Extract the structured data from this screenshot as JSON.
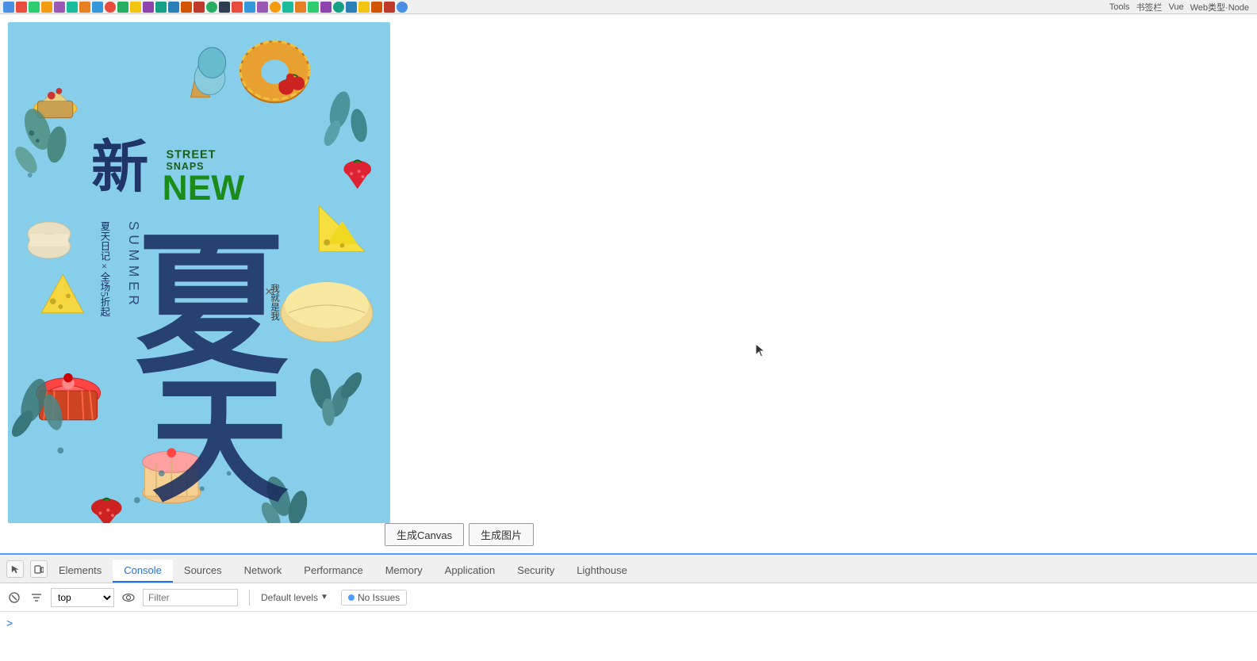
{
  "browser": {
    "topbar_bg": "#f0f0f0"
  },
  "poster": {
    "bg_color": "#87CEEB",
    "text_xin": "新",
    "text_street": "STREET",
    "text_snaps": "SNAPS",
    "text_new": "NEW",
    "text_xiatian": "夏天",
    "text_summer": "SUMMER",
    "text_riji": "夏天日记×全场5折起",
    "text_cross": "×",
    "text_wo": "我就是我"
  },
  "buttons": {
    "generate_canvas": "生成Canvas",
    "generate_image": "生成图片"
  },
  "devtools": {
    "tabs": [
      {
        "label": "Elements",
        "active": false
      },
      {
        "label": "Console",
        "active": true
      },
      {
        "label": "Sources",
        "active": false
      },
      {
        "label": "Network",
        "active": false
      },
      {
        "label": "Performance",
        "active": false
      },
      {
        "label": "Memory",
        "active": false
      },
      {
        "label": "Application",
        "active": false
      },
      {
        "label": "Security",
        "active": false
      },
      {
        "label": "Lighthouse",
        "active": false
      }
    ],
    "console": {
      "context": "top",
      "filter_placeholder": "Filter",
      "default_levels": "Default levels",
      "no_issues": "No Issues",
      "prompt": ">"
    }
  },
  "colors": {
    "accent_blue": "#4a9eff",
    "devtools_active": "#1a73e8",
    "poster_bg": "#7ec8e3",
    "poster_dark": "#1a3a6b",
    "poster_green": "#1a6b1a"
  }
}
